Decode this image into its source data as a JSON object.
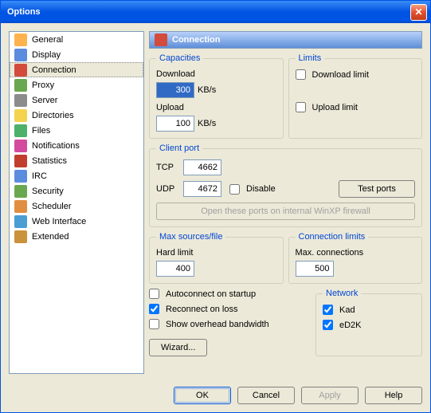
{
  "window": {
    "title": "Options"
  },
  "sidebar": {
    "items": [
      {
        "label": "General",
        "icon": "#ffb34d"
      },
      {
        "label": "Display",
        "icon": "#5b8dde"
      },
      {
        "label": "Connection",
        "icon": "#d34b3c",
        "selected": true
      },
      {
        "label": "Proxy",
        "icon": "#6aa84f"
      },
      {
        "label": "Server",
        "icon": "#8c8c8c"
      },
      {
        "label": "Directories",
        "icon": "#f4d34e"
      },
      {
        "label": "Files",
        "icon": "#4db16a"
      },
      {
        "label": "Notifications",
        "icon": "#d34b9e"
      },
      {
        "label": "Statistics",
        "icon": "#c13e2e"
      },
      {
        "label": "IRC",
        "icon": "#5b8dde"
      },
      {
        "label": "Security",
        "icon": "#6aa84f"
      },
      {
        "label": "Scheduler",
        "icon": "#e08f42"
      },
      {
        "label": "Web Interface",
        "icon": "#4a9ed4"
      },
      {
        "label": "Extended",
        "icon": "#c9923b"
      }
    ]
  },
  "header": {
    "title": "Connection"
  },
  "capacities": {
    "legend": "Capacities",
    "download_label": "Download",
    "download_value": "300",
    "download_unit": "KB/s",
    "upload_label": "Upload",
    "upload_value": "100",
    "upload_unit": "KB/s"
  },
  "limits": {
    "legend": "Limits",
    "download_label": "Download limit",
    "download_checked": false,
    "upload_label": "Upload limit",
    "upload_checked": false
  },
  "clientport": {
    "legend": "Client port",
    "tcp_label": "TCP",
    "tcp_value": "4662",
    "udp_label": "UDP",
    "udp_value": "4672",
    "disable_label": "Disable",
    "disable_checked": false,
    "test_label": "Test ports",
    "firewall_label": "Open these ports on internal WinXP firewall"
  },
  "maxsources": {
    "legend": "Max sources/file",
    "hard_label": "Hard limit",
    "value": "400"
  },
  "connlimits": {
    "legend": "Connection limits",
    "max_label": "Max. connections",
    "value": "500"
  },
  "options": {
    "autoconnect_label": "Autoconnect on startup",
    "autoconnect_checked": false,
    "reconnect_label": "Reconnect on loss",
    "reconnect_checked": true,
    "overhead_label": "Show overhead bandwidth",
    "overhead_checked": false,
    "wizard_label": "Wizard..."
  },
  "network": {
    "legend": "Network",
    "kad_label": "Kad",
    "kad_checked": true,
    "ed2k_label": "eD2K",
    "ed2k_checked": true
  },
  "buttons": {
    "ok": "OK",
    "cancel": "Cancel",
    "apply": "Apply",
    "help": "Help"
  }
}
